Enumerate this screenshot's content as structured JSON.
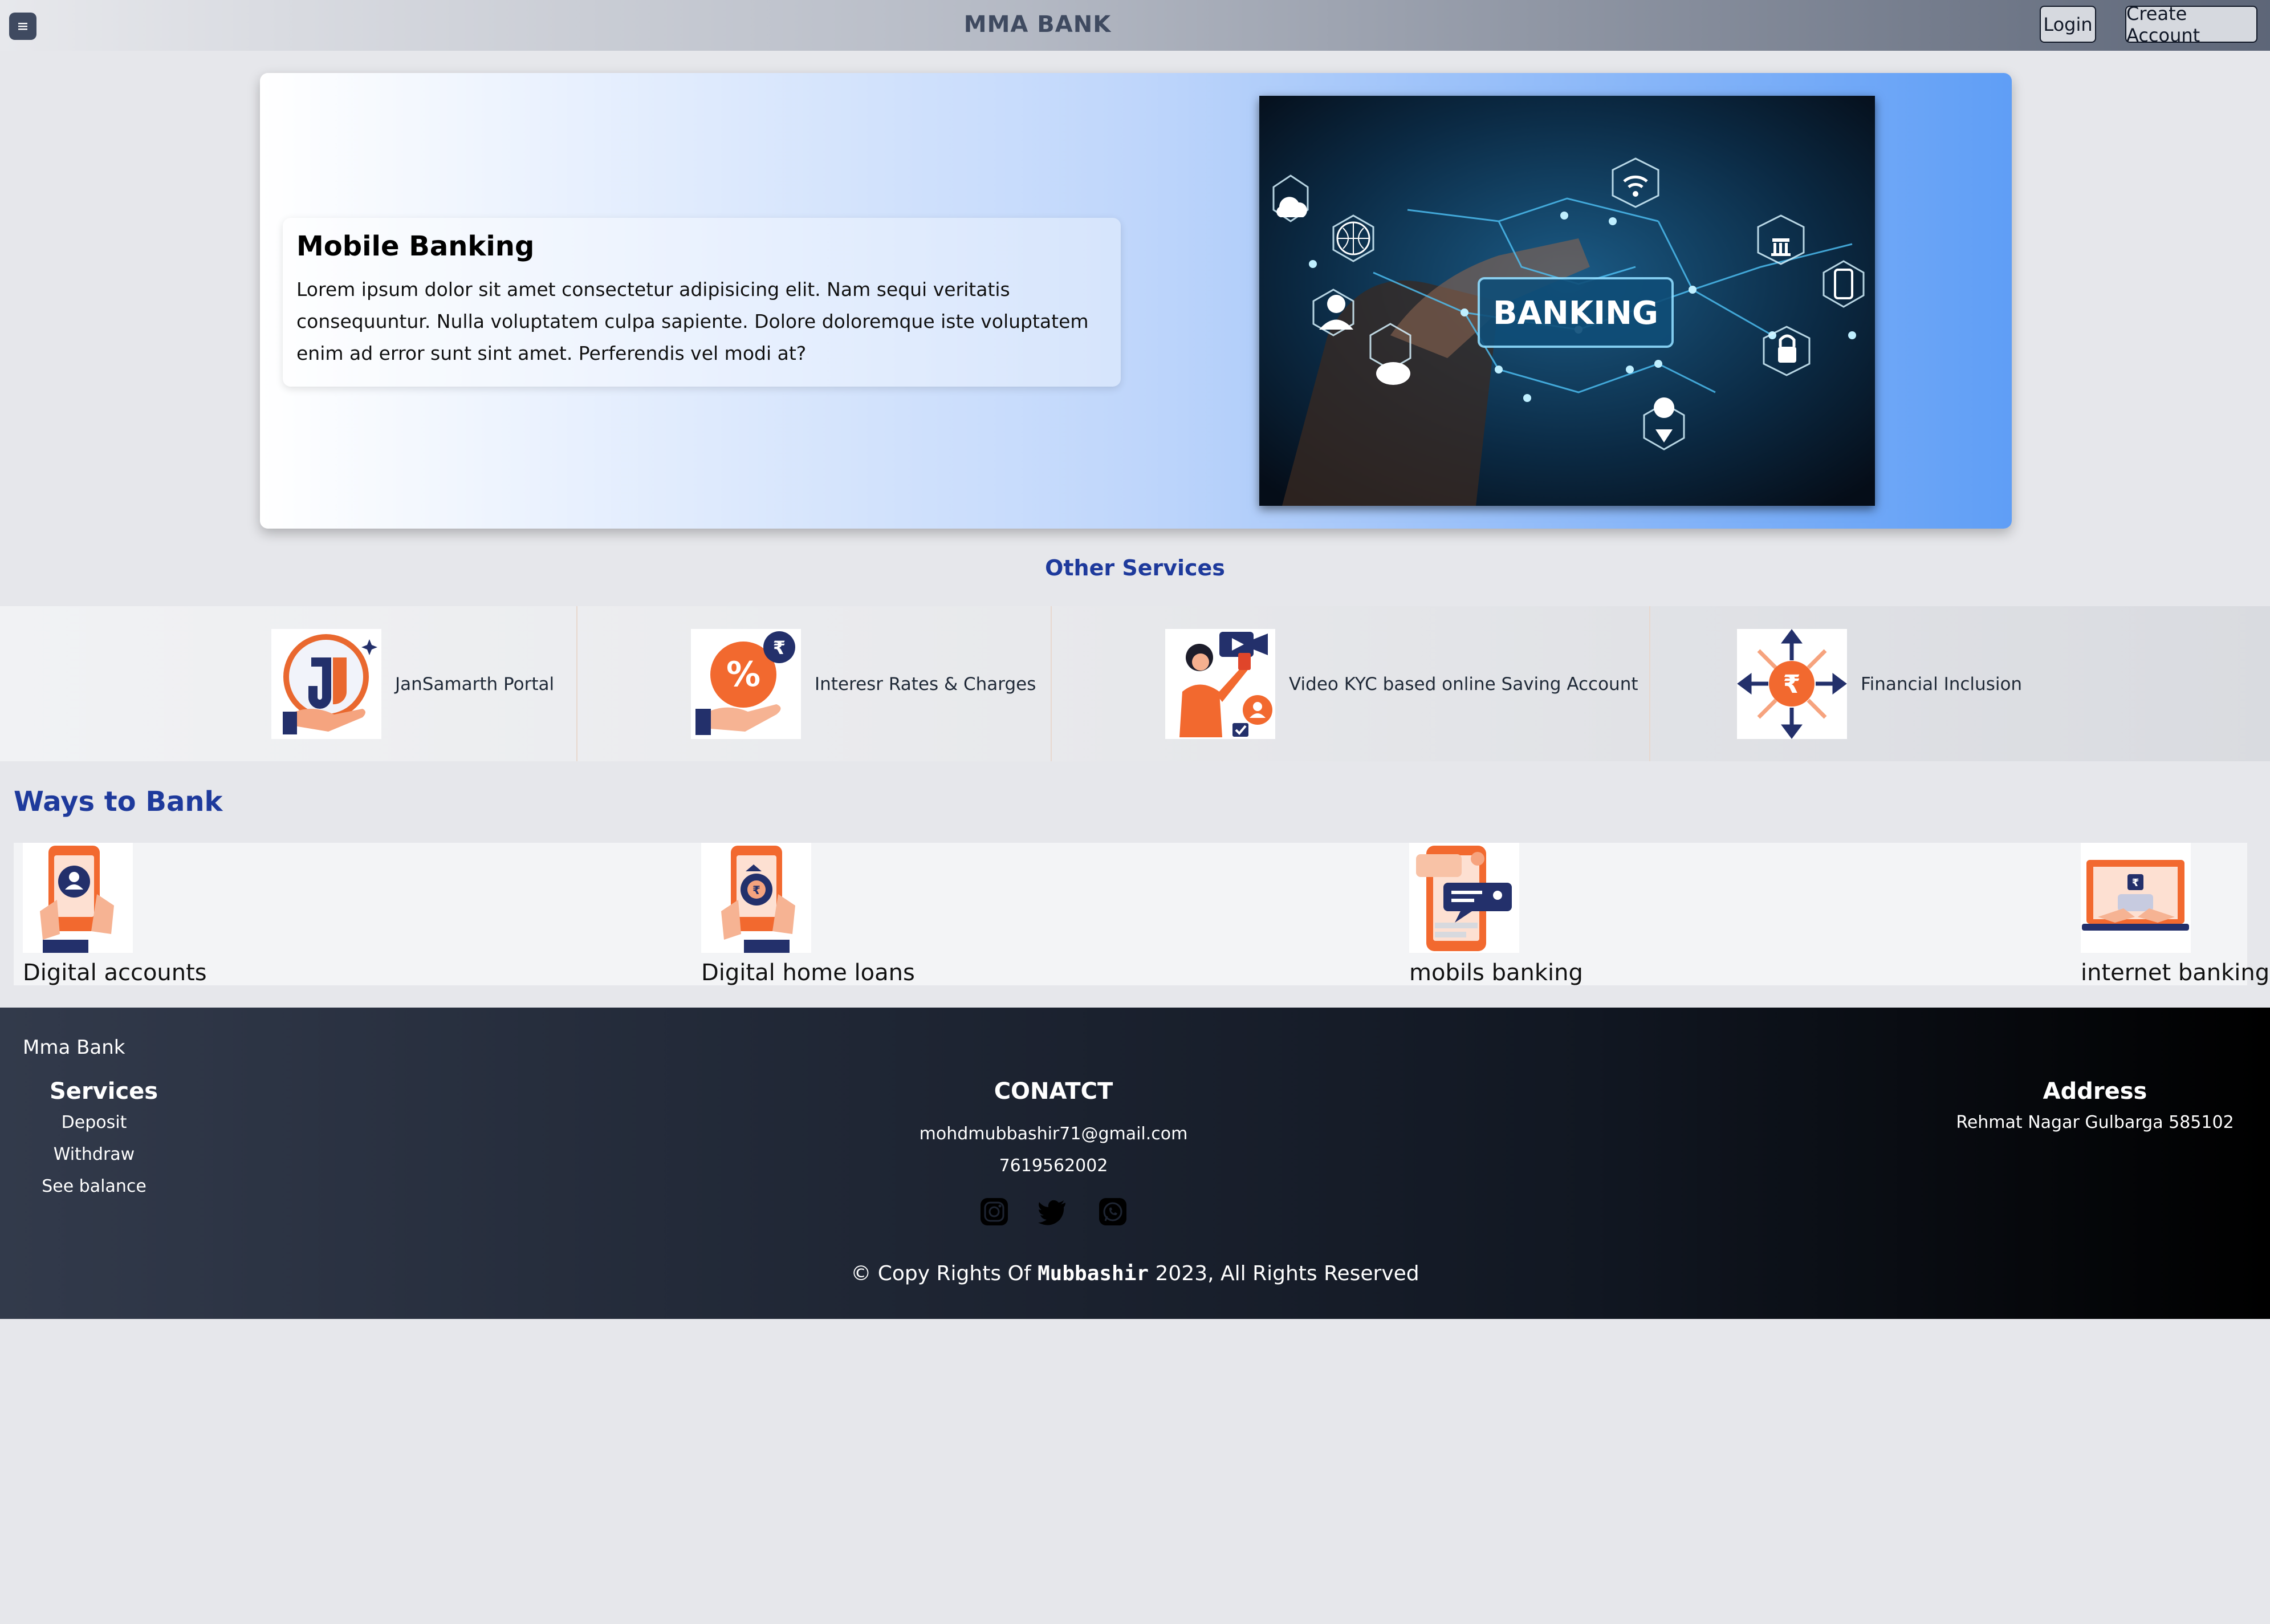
{
  "header": {
    "brand": "MMA BANK",
    "login_label": "Login",
    "create_account_label": "Create Account"
  },
  "hero": {
    "title": "Mobile Banking",
    "text": "Lorem ipsum dolor sit amet consectetur adipisicing elit. Nam sequi veritatis consequuntur. Nulla voluptatem culpa sapiente. Dolore doloremque iste voluptatem enim ad error sunt sint amet. Perferendis vel modi at?",
    "image_text": "BANKING"
  },
  "other_services": {
    "title": "Other Services",
    "items": [
      {
        "label": "JanSamarth Portal",
        "icon": "jansamarth-logo-icon"
      },
      {
        "label": "Interesr Rates & Charges",
        "icon": "percent-hand-icon"
      },
      {
        "label": "Video KYC based online Saving Account",
        "icon": "video-kyc-icon"
      },
      {
        "label": "Financial Inclusion",
        "icon": "rupee-arrows-icon"
      }
    ]
  },
  "ways_to_bank": {
    "title": "Ways to Bank",
    "items": [
      {
        "label": "Digital accounts",
        "icon": "phone-account-icon"
      },
      {
        "label": "Digital home loans",
        "icon": "phone-loan-icon"
      },
      {
        "label": "mobils banking",
        "icon": "mobile-chat-icon"
      },
      {
        "label": "internet banking",
        "icon": "laptop-banking-icon"
      }
    ]
  },
  "footer": {
    "brand": "Mma Bank",
    "services_title": "Services",
    "services": [
      "Deposit",
      "Withdraw",
      "See balance"
    ],
    "contact_title": "CONATCT",
    "email": "mohdmubbashir71@gmail.com",
    "phone": "7619562002",
    "address_title": "Address",
    "address": "Rehmat Nagar Gulbarga 585102",
    "social": [
      "instagram-icon",
      "twitter-icon",
      "whatsapp-icon"
    ],
    "copyright_prefix": "© Copy Rights Of",
    "copyright_name": "Mubbashir",
    "copyright_suffix": "2023, All Rights Reserved"
  },
  "colors": {
    "accent": "#1e3a9c",
    "orange": "#f2692f",
    "navy": "#1f2a5a"
  }
}
